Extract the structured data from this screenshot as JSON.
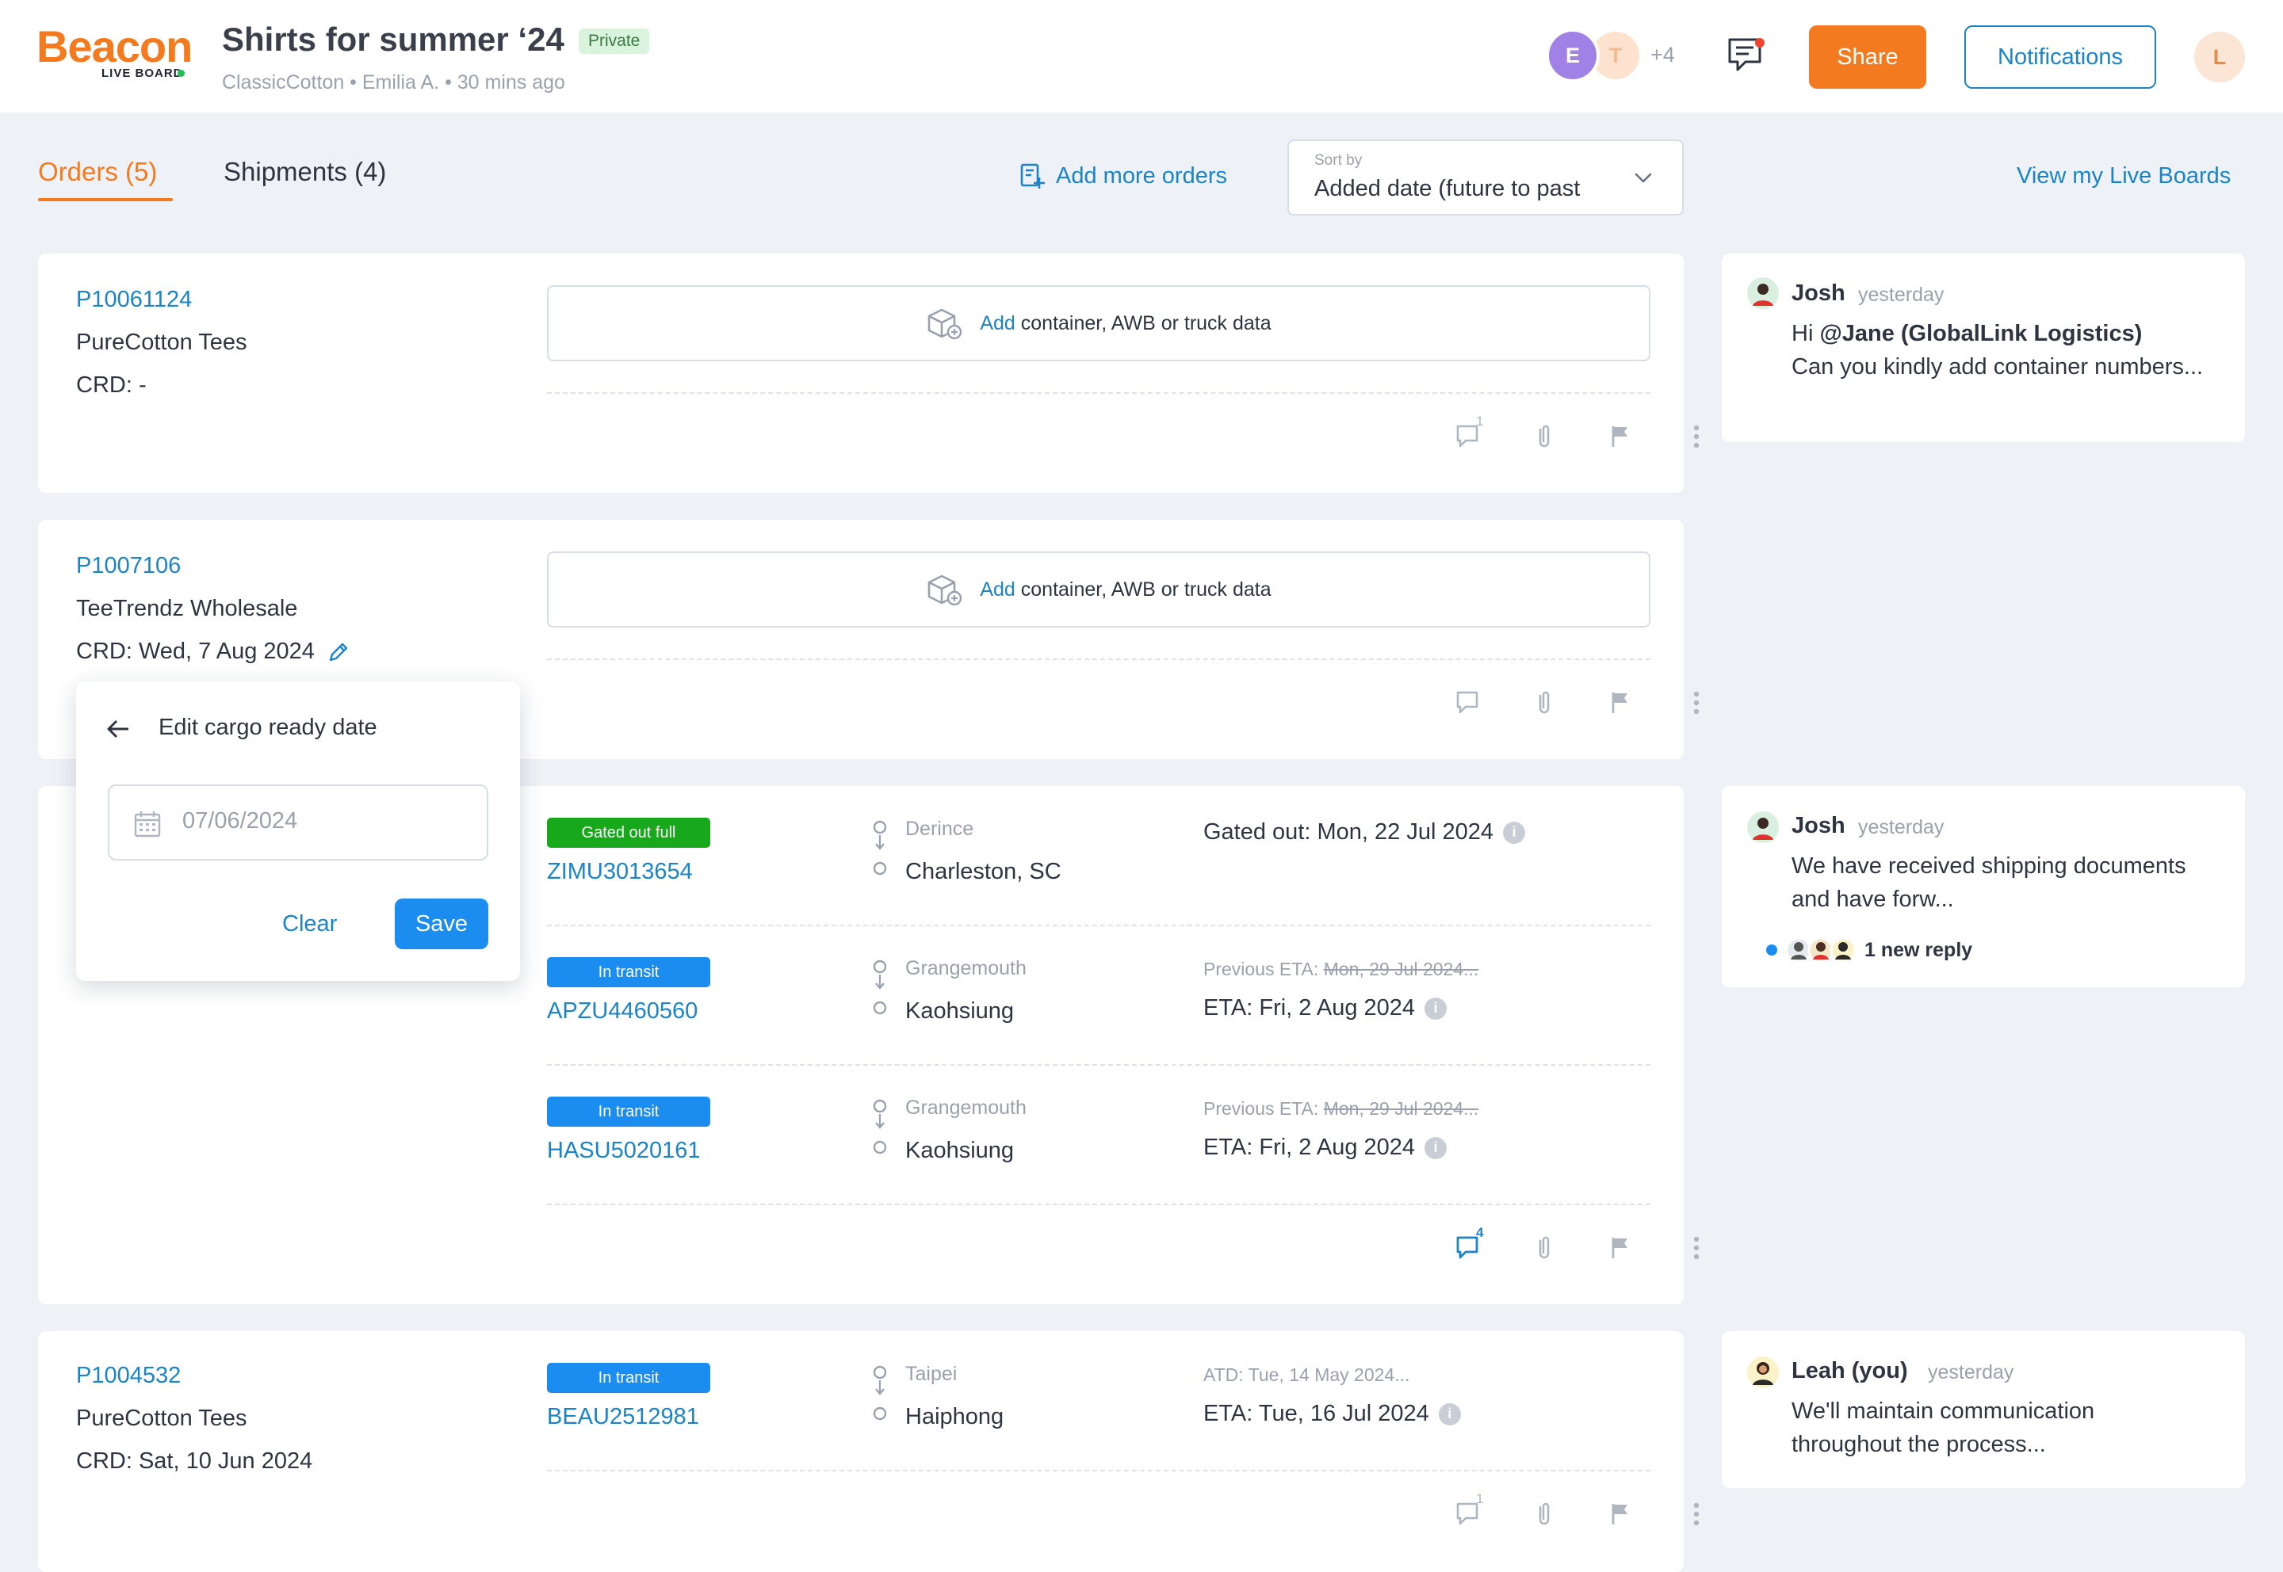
{
  "header": {
    "logo": "Beacon",
    "logo_sub": "LIVE BOARD",
    "title": "Shirts for summer ‘24",
    "privacy_badge": "Private",
    "meta": "ClassicCotton • Emilia A. • 30 mins ago",
    "avatars": [
      "E",
      "T"
    ],
    "more_count": "+4",
    "share_label": "Share",
    "notifications_label": "Notifications",
    "user_initial": "L"
  },
  "toolbar": {
    "tab_orders": "Orders (5)",
    "tab_shipments": "Shipments (4)",
    "add_orders": "Add more orders",
    "sort_label": "Sort by",
    "sort_value": "Added date (future to past",
    "view_boards": "View my Live Boards"
  },
  "add_container": {
    "link": "Add",
    "text": "container, AWB or truck data"
  },
  "orders": [
    {
      "id": "P10061124",
      "name": "PureCotton Tees",
      "crd": "CRD: -",
      "comment_count": "1"
    },
    {
      "id": "P1007106",
      "name": "TeeTrendz Wholesale",
      "crd": "CRD: Wed, 7 Aug 2024"
    },
    {
      "comment_count": "4",
      "containers": [
        {
          "status": "Gated out full",
          "status_color": "#17a81b",
          "id": "ZIMU3013654",
          "from": "Derince",
          "to": "Charleston, SC",
          "prev": "",
          "eta": "Gated out: Mon, 22 Jul 2024"
        },
        {
          "status": "In transit",
          "status_color": "#1b8cf0",
          "id": "APZU4460560",
          "from": "Grangemouth",
          "to": "Kaohsiung",
          "prev_label": "Previous ETA:",
          "prev": "Mon, 29 Jul 2024...",
          "eta": "ETA: Fri, 2 Aug 2024"
        },
        {
          "status": "In transit",
          "status_color": "#1b8cf0",
          "id": "HASU5020161",
          "from": "Grangemouth",
          "to": "Kaohsiung",
          "prev_label": "Previous ETA:",
          "prev": "Mon, 29 Jul 2024...",
          "eta": "ETA: Fri, 2 Aug 2024"
        }
      ]
    },
    {
      "id": "P1004532",
      "name": "PureCotton Tees",
      "crd": "CRD: Sat, 10 Jun 2024",
      "comment_count": "1",
      "containers": [
        {
          "status": "In transit",
          "status_color": "#1b8cf0",
          "id": "BEAU2512981",
          "from": "Taipei",
          "to": "Haiphong",
          "atd": "ATD: Tue, 14 May 2024...",
          "eta": "ETA: Tue, 16 Jul 2024"
        }
      ]
    }
  ],
  "popover": {
    "title": "Edit cargo ready date",
    "date_placeholder": "07/06/2024",
    "clear": "Clear",
    "save": "Save"
  },
  "comments": [
    {
      "author": "Josh",
      "time": "yesterday",
      "mention": "@Jane (GlobalLink Logistics)",
      "prefix": "Hi",
      "text": "Can you kindly add container numbers..."
    },
    {
      "author": "Josh",
      "time": "yesterday",
      "text": "We have received shipping documents and have forw...",
      "reply": "1 new reply"
    },
    {
      "author": "Leah (you)",
      "time": "yesterday",
      "text": "We'll maintain communication throughout the process..."
    }
  ],
  "colors": {
    "brand_orange": "#f47a20",
    "link_blue": "#1b83c7",
    "status_green": "#17a81b",
    "status_blue": "#1b8cf0"
  },
  "icons": [
    "message-icon",
    "paperclip-icon",
    "flag-icon",
    "kebab-icon",
    "add-box-icon",
    "pencil-icon",
    "calendar-icon",
    "back-arrow-icon",
    "chevron-down-icon",
    "add-orders-icon",
    "info-icon"
  ]
}
